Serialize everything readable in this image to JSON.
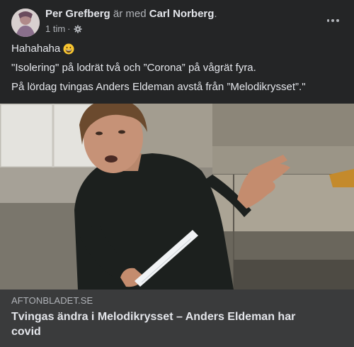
{
  "post": {
    "author": "Per Grefberg",
    "with_text": "är med",
    "tagged": "Carl Norberg",
    "tagged_suffix": ".",
    "time": "1 tim",
    "time_sep": "·",
    "privacy_icon": "gear-icon",
    "more_icon": "more-options-icon",
    "lines": [
      "Hahahaha",
      "\"Isolering\" på lodrät två och ”Corona” på vågrät fyra.",
      "På lördag tvingas Anders Eldeman avstå från ”Melodikrysset”.\""
    ],
    "emoji": "grinning-face-emoji"
  },
  "link": {
    "domain": "AFTONBLADET.SE",
    "title": "Tvingas ändra i Melodikrysset – Anders Eldeman har covid"
  },
  "colors": {
    "background": "#242526",
    "card": "#3a3b3c",
    "text_primary": "#e4e6eb",
    "text_secondary": "#b0b3b8"
  }
}
